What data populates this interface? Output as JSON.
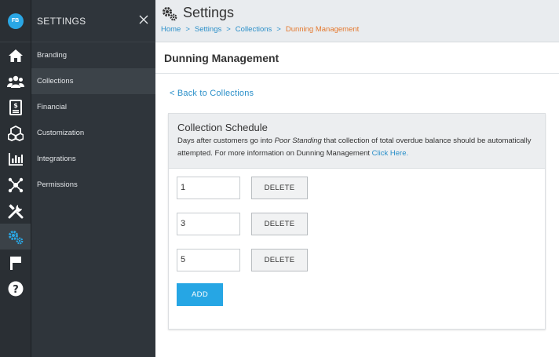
{
  "app": {
    "logo_text": "FB"
  },
  "settings_panel": {
    "title": "SETTINGS",
    "items": [
      {
        "label": "Branding"
      },
      {
        "label": "Collections"
      },
      {
        "label": "Financial"
      },
      {
        "label": "Customization"
      },
      {
        "label": "Integrations"
      },
      {
        "label": "Permissions"
      }
    ]
  },
  "header": {
    "title": "Settings",
    "breadcrumb": [
      {
        "label": "Home"
      },
      {
        "label": "Settings"
      },
      {
        "label": "Collections"
      },
      {
        "label": "Dunning Management"
      }
    ],
    "separator": ">"
  },
  "page": {
    "title": "Dunning Management",
    "back_link": "< Back to Collections"
  },
  "card": {
    "title": "Collection Schedule",
    "desc_before": "Days after customers go into ",
    "desc_em": "Poor Standing",
    "desc_after": " that collection of total overdue balance should be automatically attempted. For more information on Dunning Management ",
    "desc_link": "Click Here."
  },
  "schedule": {
    "rows": [
      {
        "value": "1",
        "delete_label": "DELETE"
      },
      {
        "value": "3",
        "delete_label": "DELETE"
      },
      {
        "value": "5",
        "delete_label": "DELETE"
      }
    ],
    "add_label": "ADD"
  },
  "colors": {
    "accent": "#26a6e4",
    "link": "#2a8fc9",
    "breadcrumb_current": "#e4782d",
    "sidebar_bg": "#2f353b",
    "rail_bg": "#2a2f34"
  },
  "icons": {
    "rail": [
      "home-icon",
      "customers-icon",
      "invoice-icon",
      "items-icon",
      "reports-icon",
      "network-icon",
      "tools-icon",
      "settings-gears-icon",
      "flag-icon",
      "help-icon"
    ],
    "header": "settings-gears-icon",
    "close": "close-icon"
  }
}
